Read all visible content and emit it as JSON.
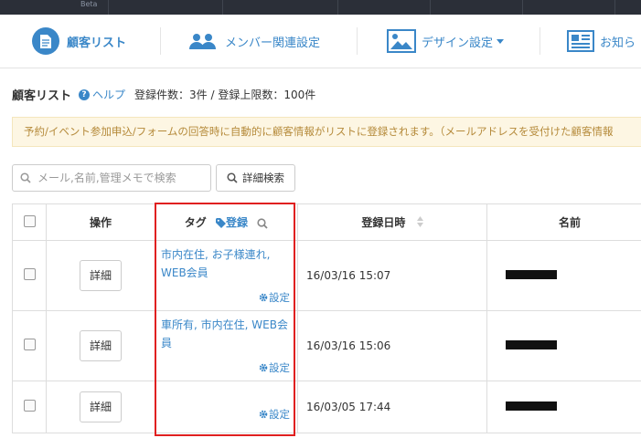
{
  "topbar": {
    "beta_label": "Beta"
  },
  "nav": {
    "items": [
      {
        "label": "顧客リスト",
        "active": true
      },
      {
        "label": "メンバー関連設定"
      },
      {
        "label": "デザイン設定"
      },
      {
        "label": "お知ら"
      }
    ]
  },
  "header": {
    "title": "顧客リスト",
    "help_label": "ヘルプ",
    "count_text": "登録件数：3件 / 登録上限数：100件"
  },
  "notice": "予約/イベント参加申込/フォームの回答時に自動的に顧客情報がリストに登録されます。（メールアドレスを受付けた顧客情報",
  "search": {
    "placeholder": "メール,名前,管理メモで検索",
    "advanced_label": "詳細検索"
  },
  "table": {
    "headers": {
      "ops": "操作",
      "tag": "タグ",
      "tag_register": "登録",
      "date": "登録日時",
      "name": "名前"
    },
    "detail_label": "詳細",
    "setting_label": "設定",
    "rows": [
      {
        "tags": "市内在住, お子様連れ, WEB会員",
        "date": "16/03/16 15:07"
      },
      {
        "tags": "車所有, 市内在住, WEB会員",
        "date": "16/03/16 15:06"
      },
      {
        "tags": "",
        "date": "16/03/05 17:44"
      }
    ]
  },
  "colors": {
    "accent": "#3a87c8",
    "highlight_border": "#e02020",
    "notice_bg": "#fdf6e3",
    "notice_text": "#b58a3a"
  }
}
